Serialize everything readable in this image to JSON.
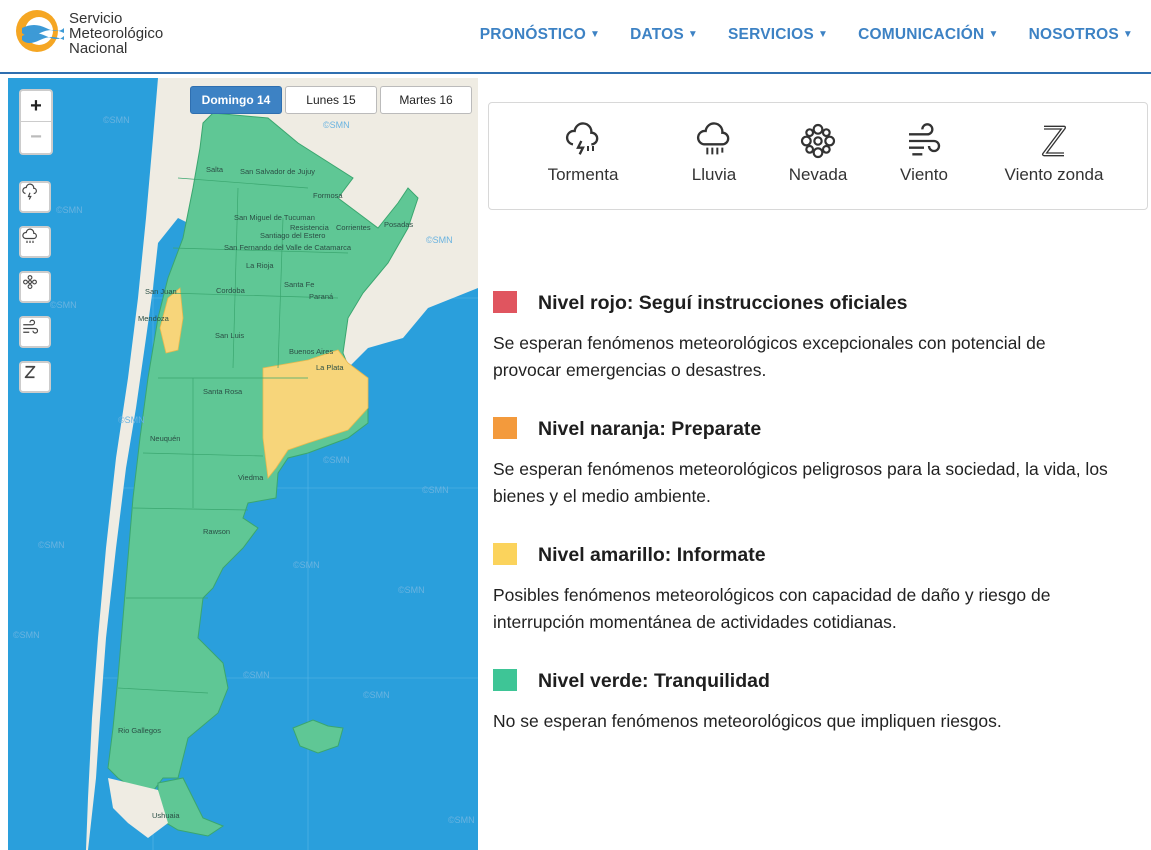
{
  "brand": {
    "line1": "Servicio",
    "line2": "Meteorológico",
    "line3": "Nacional"
  },
  "nav": [
    {
      "label": "PRONÓSTICO"
    },
    {
      "label": "DATOS"
    },
    {
      "label": "SERVICIOS"
    },
    {
      "label": "COMUNICACIÓN"
    },
    {
      "label": "NOSOTROS"
    }
  ],
  "map": {
    "days": [
      {
        "label": "Domingo 14",
        "active": true
      },
      {
        "label": "Lunes 15",
        "active": false
      },
      {
        "label": "Martes 16",
        "active": false
      }
    ],
    "zoom_in": "+",
    "zoom_out": "−",
    "watermark": "©SMN",
    "cities": [
      "Salta",
      "San Salvador de Jujuy",
      "Formosa",
      "San Miguel de Tucuman",
      "Resistencia",
      "Corrientes",
      "Posadas",
      "Santiago del Estero",
      "San Fernando del Valle de Catamarca",
      "La Rioja",
      "San Juan",
      "Cordoba",
      "Santa Fe",
      "Paraná",
      "Mendoza",
      "San Luis",
      "Buenos Aires",
      "La Plata",
      "Santa Rosa",
      "Neuquén",
      "Viedma",
      "Rawson",
      "Rio Gallegos",
      "Ushuaia"
    ]
  },
  "phenomena": [
    {
      "label": "Tormenta",
      "icon": "storm-icon"
    },
    {
      "label": "Lluvia",
      "icon": "rain-icon"
    },
    {
      "label": "Nevada",
      "icon": "snow-icon"
    },
    {
      "label": "Viento",
      "icon": "wind-icon"
    },
    {
      "label": "Viento zonda",
      "icon": "zonda-icon"
    }
  ],
  "levels": [
    {
      "title": "Nivel rojo: Seguí instrucciones oficiales",
      "color": "#e0555f",
      "desc": "Se esperan fenómenos meteorológicos excepcionales con potencial de provocar emergencias o desastres."
    },
    {
      "title": "Nivel naranja: Preparate",
      "color": "#f39a3c",
      "desc": "Se esperan fenómenos meteorológicos peligrosos para la sociedad, la vida, los bienes y el medio ambiente."
    },
    {
      "title": "Nivel amarillo: Informate",
      "color": "#fbd35c",
      "desc": "Posibles fenómenos meteorológicos con capacidad de daño y riesgo de interrupción momentánea de actividades cotidianas."
    },
    {
      "title": "Nivel verde: Tranquilidad",
      "color": "#3ec596",
      "desc": "No se esperan fenómenos meteorológicos que impliquen riesgos."
    }
  ],
  "colors": {
    "brand_blue": "#3d82c4",
    "ocean": "#2a9fdc",
    "land": "#efece3",
    "green_zone": "#5fc795",
    "yellow_zone": "#f7d57a"
  }
}
